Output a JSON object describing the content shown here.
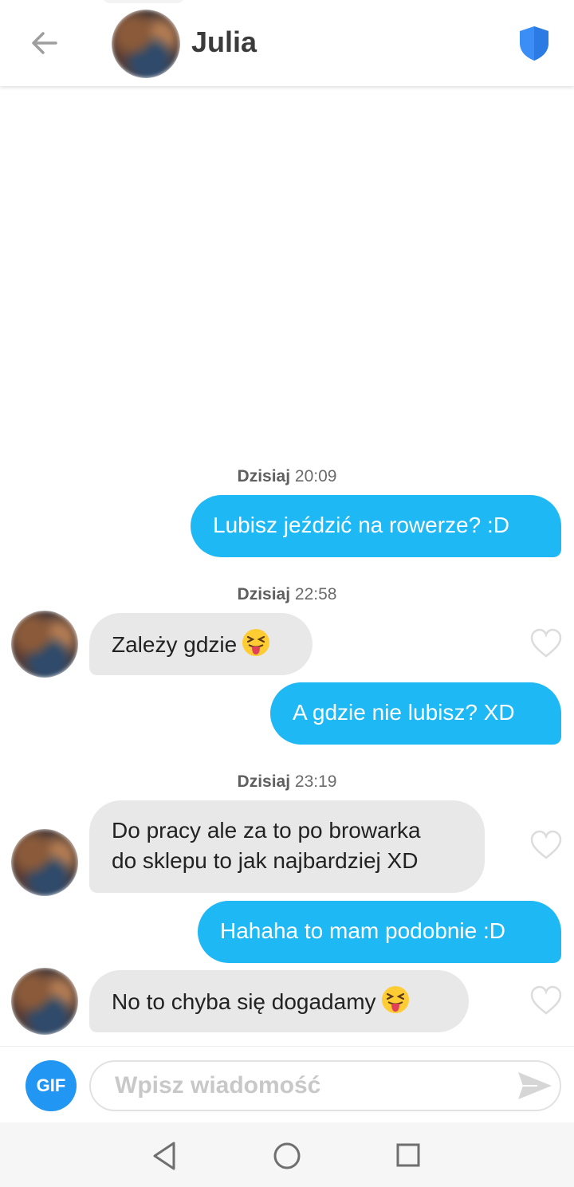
{
  "header": {
    "contact_name": "Julia",
    "back_icon": "arrow-left-icon",
    "safety_icon": "shield-icon",
    "accent_color": "#3a8ef5"
  },
  "messages": [
    {
      "type": "timestamp",
      "day": "Dzisiaj",
      "time": "20:09"
    },
    {
      "type": "outgoing",
      "text": "Lubisz jeździć na rowerze? :D"
    },
    {
      "type": "timestamp",
      "day": "Dzisiaj",
      "time": "22:58"
    },
    {
      "type": "incoming",
      "text": "Zależy gdzie",
      "emoji": "squinting-face-with-tongue"
    },
    {
      "type": "outgoing",
      "text": "A gdzie nie lubisz? XD"
    },
    {
      "type": "timestamp",
      "day": "Dzisiaj",
      "time": "23:19"
    },
    {
      "type": "incoming",
      "lines": [
        "Do pracy ale za to po browarka",
        "do sklepu to jak najbardziej XD"
      ]
    },
    {
      "type": "outgoing",
      "text": "Hahaha to mam podobnie :D"
    },
    {
      "type": "incoming",
      "text": "No to chyba się dogadamy",
      "emoji": "squinting-face-with-tongue"
    }
  ],
  "composer": {
    "gif_label": "GIF",
    "placeholder": "Wpisz wiadomość",
    "send_icon": "send-icon"
  },
  "colors": {
    "outgoing_bubble": "#1eb8f4",
    "incoming_bubble": "#e8e8e8",
    "gif_button": "#2196f3"
  },
  "navbar": {
    "icons": [
      "nav-back-icon",
      "nav-home-icon",
      "nav-recents-icon"
    ]
  }
}
